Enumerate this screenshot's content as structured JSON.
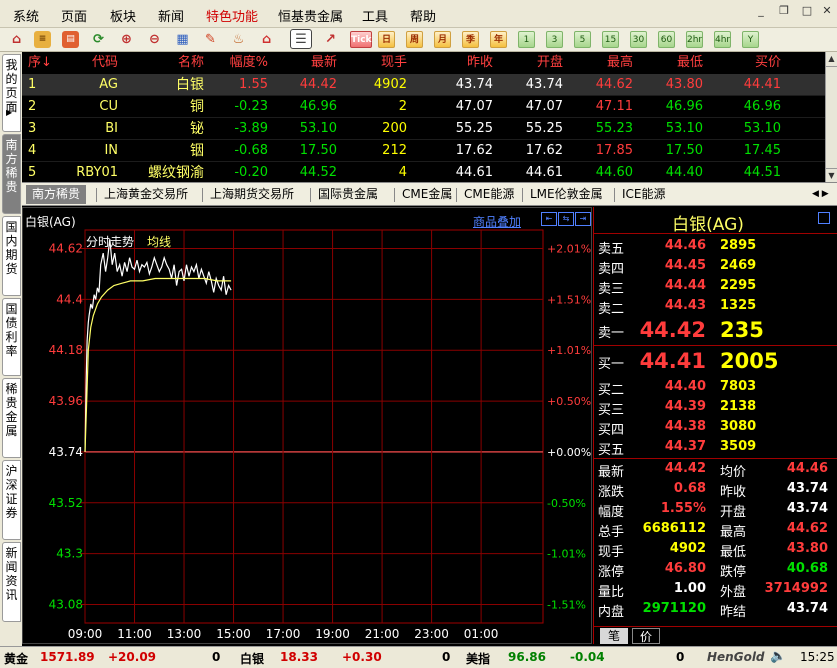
{
  "menu": [
    "系统",
    "页面",
    "板块",
    "新闻",
    "特色功能",
    "恒基贵金属",
    "工具",
    "帮助"
  ],
  "menu_highlight_index": 4,
  "toolbar": {
    "text_buttons": [
      "Tick",
      "日",
      "周",
      "月",
      "季",
      "年"
    ],
    "period_buttons": [
      "1",
      "3",
      "5",
      "15",
      "30",
      "60",
      "2hr",
      "4hr",
      "Y"
    ]
  },
  "left_tabs": [
    "我的页面",
    "南方稀贵",
    "国内期货",
    "国债利率",
    "稀贵金属",
    "沪深证券",
    "新闻资讯"
  ],
  "left_tab_active": 1,
  "quote_table": {
    "headers": [
      "序↓",
      "代码",
      "名称",
      "幅度%",
      "最新",
      "现手",
      "昨收",
      "开盘",
      "最高",
      "最低",
      "买价"
    ],
    "rows": [
      {
        "no": "1",
        "code": "AG",
        "name": "白银",
        "change": "1.55",
        "last": "44.42",
        "vol": "4902",
        "prev": "43.74",
        "open": "43.74",
        "high": "44.62",
        "low": "43.80",
        "bid": "44.41"
      },
      {
        "no": "2",
        "code": "CU",
        "name": "铜",
        "change": "-0.23",
        "last": "46.96",
        "vol": "2",
        "prev": "47.07",
        "open": "47.07",
        "high": "47.11",
        "low": "46.96",
        "bid": "46.96"
      },
      {
        "no": "3",
        "code": "BI",
        "name": "铋",
        "change": "-3.89",
        "last": "53.10",
        "vol": "200",
        "prev": "55.25",
        "open": "55.25",
        "high": "55.23",
        "low": "53.10",
        "bid": "53.10"
      },
      {
        "no": "4",
        "code": "IN",
        "name": "铟",
        "change": "-0.68",
        "last": "17.50",
        "vol": "212",
        "prev": "17.62",
        "open": "17.62",
        "high": "17.85",
        "low": "17.50",
        "bid": "17.45"
      },
      {
        "no": "5",
        "code": "RBY01",
        "name": "螺纹钢渝",
        "change": "-0.20",
        "last": "44.52",
        "vol": "4",
        "prev": "44.61",
        "open": "44.61",
        "high": "44.60",
        "low": "44.40",
        "bid": "44.51"
      }
    ]
  },
  "market_tabs": [
    "南方稀贵",
    "上海黄金交易所",
    "上海期货交易所",
    "国际贵金属",
    "CME金属",
    "CME能源",
    "LME伦敦金属",
    "ICE能源"
  ],
  "market_tab_active": 0,
  "chart_panel": {
    "title": "白银(AG)",
    "overlay_link": "商品叠加",
    "series_label": "分时走势",
    "avg_label": "均线"
  },
  "chart_data": {
    "type": "line",
    "ylim": [
      43.0,
      44.7
    ],
    "prev_close": 43.74,
    "y_ticks": [
      44.62,
      44.4,
      44.18,
      43.96,
      43.74,
      43.52,
      43.3,
      43.08
    ],
    "pct_ticks": [
      "+2.01%",
      "+1.51%",
      "+1.01%",
      "+0.50%",
      "+0.00%",
      "-0.50%",
      "-1.01%",
      "-1.51%"
    ],
    "x_ticks": [
      "09:00",
      "11:00",
      "13:00",
      "15:00",
      "17:00",
      "19:00",
      "21:00",
      "23:00",
      "01:00"
    ],
    "x_range_minutes": [
      0,
      1110
    ],
    "series": [
      {
        "name": "分时走势",
        "color": "#ffffff",
        "x": [
          0,
          3,
          5,
          8,
          10,
          14,
          18,
          22,
          26,
          30,
          34,
          38,
          44,
          50,
          55,
          60,
          66,
          72,
          78,
          84,
          90,
          96,
          102,
          108,
          114,
          120,
          126,
          132,
          138,
          144,
          150,
          156,
          162,
          168,
          174,
          180,
          186,
          192,
          198,
          204,
          210,
          216,
          222,
          228,
          234,
          240,
          246,
          252,
          258,
          264,
          270,
          276,
          282,
          288,
          294,
          300,
          306,
          312,
          318,
          324,
          330,
          336,
          342,
          348,
          354
        ],
        "y": [
          43.74,
          44.05,
          44.22,
          44.3,
          44.33,
          44.38,
          44.36,
          44.42,
          44.4,
          44.45,
          44.43,
          44.55,
          44.6,
          44.52,
          44.58,
          44.66,
          44.55,
          44.6,
          44.52,
          44.55,
          44.5,
          44.56,
          44.52,
          44.58,
          44.54,
          44.53,
          44.57,
          44.52,
          44.55,
          44.54,
          44.56,
          44.51,
          44.54,
          44.58,
          44.55,
          44.52,
          44.54,
          44.58,
          44.55,
          44.53,
          44.49,
          44.55,
          44.46,
          44.52,
          44.53,
          44.48,
          44.55,
          44.5,
          44.54,
          44.52,
          44.55,
          44.49,
          44.53,
          44.5,
          44.47,
          44.52,
          44.48,
          44.43,
          44.49,
          44.46,
          44.44,
          44.5,
          44.42,
          44.46,
          44.44
        ]
      },
      {
        "name": "均线",
        "color": "#ffff66",
        "x": [
          0,
          4,
          8,
          14,
          20,
          30,
          40,
          55,
          70,
          90,
          110,
          140,
          170,
          200,
          230,
          260,
          290,
          320,
          354
        ],
        "y": [
          43.74,
          43.96,
          44.18,
          44.28,
          44.33,
          44.38,
          44.41,
          44.44,
          44.46,
          44.47,
          44.48,
          44.48,
          44.49,
          44.49,
          44.49,
          44.49,
          44.49,
          44.48,
          44.48
        ]
      }
    ],
    "grid": true
  },
  "right_panel": {
    "title": "白银(AG)",
    "asks": [
      {
        "label": "卖五",
        "price": "44.46",
        "vol": "2895"
      },
      {
        "label": "卖四",
        "price": "44.45",
        "vol": "2469"
      },
      {
        "label": "卖三",
        "price": "44.44",
        "vol": "2295"
      },
      {
        "label": "卖二",
        "price": "44.43",
        "vol": "1325"
      }
    ],
    "ask1": {
      "label": "卖一",
      "price": "44.42",
      "vol": "235"
    },
    "bid1": {
      "label": "买一",
      "price": "44.41",
      "vol": "2005"
    },
    "bids": [
      {
        "label": "买二",
        "price": "44.40",
        "vol": "7803"
      },
      {
        "label": "买三",
        "price": "44.39",
        "vol": "2138"
      },
      {
        "label": "买四",
        "price": "44.38",
        "vol": "3080"
      },
      {
        "label": "买五",
        "price": "44.37",
        "vol": "3509"
      }
    ],
    "stats": [
      {
        "l1": "最新",
        "v1": "44.42",
        "c1": "red",
        "l2": "均价",
        "v2": "44.46",
        "c2": "red"
      },
      {
        "l1": "涨跌",
        "v1": "0.68",
        "c1": "red",
        "l2": "昨收",
        "v2": "43.74",
        "c2": "white"
      },
      {
        "l1": "幅度",
        "v1": "1.55%",
        "c1": "red",
        "l2": "开盘",
        "v2": "43.74",
        "c2": "white"
      },
      {
        "l1": "总手",
        "v1": "6686112",
        "c1": "yellow",
        "l2": "最高",
        "v2": "44.62",
        "c2": "red"
      },
      {
        "l1": "现手",
        "v1": "4902",
        "c1": "yellow",
        "l2": "最低",
        "v2": "43.80",
        "c2": "red"
      },
      {
        "l1": "涨停",
        "v1": "46.80",
        "c1": "red",
        "l2": "跌停",
        "v2": "40.68",
        "c2": "green"
      },
      {
        "l1": "量比",
        "v1": "1.00",
        "c1": "white",
        "l2": "外盘",
        "v2": "3714992",
        "c2": "red"
      },
      {
        "l1": "内盘",
        "v1": "2971120",
        "c1": "green",
        "l2": "昨结",
        "v2": "43.74",
        "c2": "white"
      }
    ],
    "bottom_tabs": [
      "笔",
      "价"
    ]
  },
  "status_bar": {
    "gold_label": "黄金",
    "gold_price": "1571.89",
    "gold_change": "+20.09",
    "gold_vol": "0",
    "silver_label": "白银",
    "silver_price": "18.33",
    "silver_change": "+0.30",
    "silver_vol": "0",
    "usd_label": "美指",
    "usd_price": "96.86",
    "usd_change": "-0.04",
    "usd_vol": "0",
    "brand": "HenGold",
    "time": "15:25"
  }
}
